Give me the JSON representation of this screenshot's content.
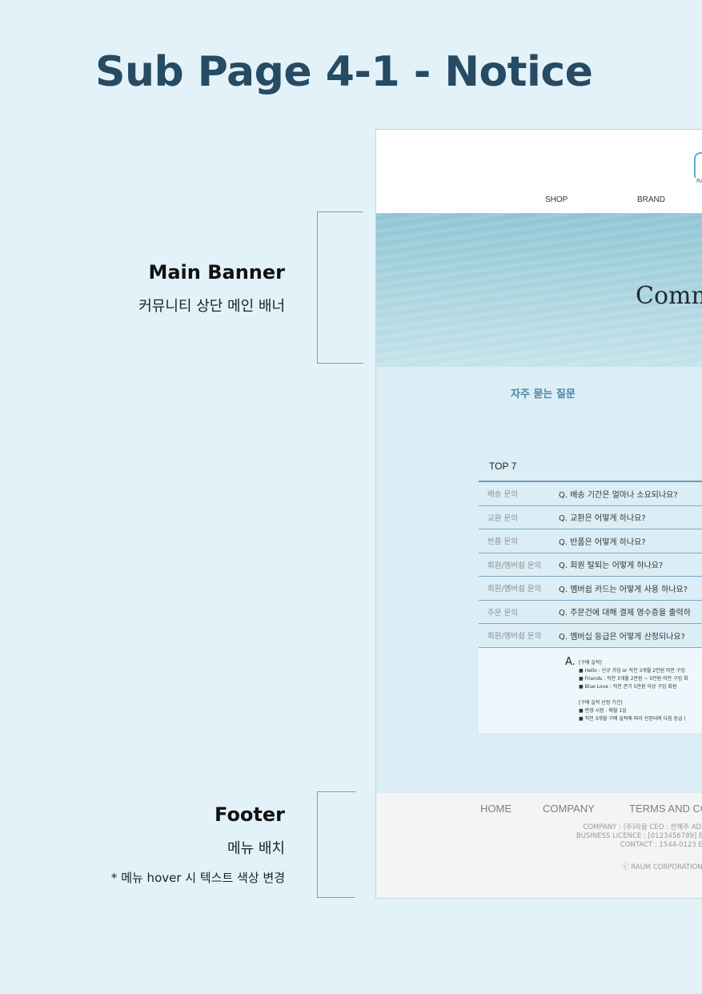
{
  "title": "Sub Page 4-1 - Notice",
  "annotations": {
    "banner": {
      "title": "Main Banner",
      "subtitle": "커뮤니티 상단 메인 배너"
    },
    "footer": {
      "title": "Footer",
      "subtitle": "메뉴 배치",
      "note": "* 메뉴 hover 시 텍스트 색상 변경"
    }
  },
  "mock": {
    "logo_text": "RA",
    "nav": [
      "SHOP",
      "BRAND"
    ],
    "banner_title": "Comm",
    "faq_heading": "자주 묻는 질문",
    "top_label": "TOP 7",
    "faq": [
      {
        "category": "배송 문의",
        "question": "Q.  배송 기간은 얼마나 소요되나요?"
      },
      {
        "category": "교환 문의",
        "question": "Q.  교환은 어떻게 하나요?"
      },
      {
        "category": "반품 문의",
        "question": "Q.  반품은 어떻게 하나요?"
      },
      {
        "category": "회원/멤버쉽 문의",
        "question": "Q.  회원 탈퇴는 어떻게 하나요?"
      },
      {
        "category": "회원/멤버쉽 문의",
        "question": "Q.  멤버쉽 카드는 어떻게 사용 하나요?"
      },
      {
        "category": "주문 문의",
        "question": "Q.  주문건에 대해 결제 영수증을 출력하"
      },
      {
        "category": "회원/멤버쉽 문의",
        "question": "Q.  멤버십 등급은 어떻게 산정되나요?"
      }
    ],
    "answer": {
      "mark": "A.",
      "lines": [
        "[구매 실적]",
        "■ Hello : 신규 가입 or 직전 3개월 2만원 미만 구입",
        "■ Friends : 직전 3개월 2만원 ~ 5만원 미만 구입 회",
        "■ Blue Love : 직전 분기 5만원 이상 구입 회원",
        "",
        "[구매 실적 산정 기간]",
        "■ 변경 시점 : 매월 1일",
        "■ 직전 3개월 구매 실적에 따라 선정되며 다음 등급 ("
      ]
    },
    "footer": {
      "nav": [
        "HOME",
        "COMPANY",
        "TERMS AND CO"
      ],
      "info": [
        "COMPANY : (주)라움 CEO : 한혜주 ADDRE",
        "BUSINESS LICENCE : [0123456789]   E-CO",
        "CONTACT : 1544-0123 E-MA"
      ],
      "copyright": "ⓒ RAUM CORPORATION. A"
    }
  }
}
